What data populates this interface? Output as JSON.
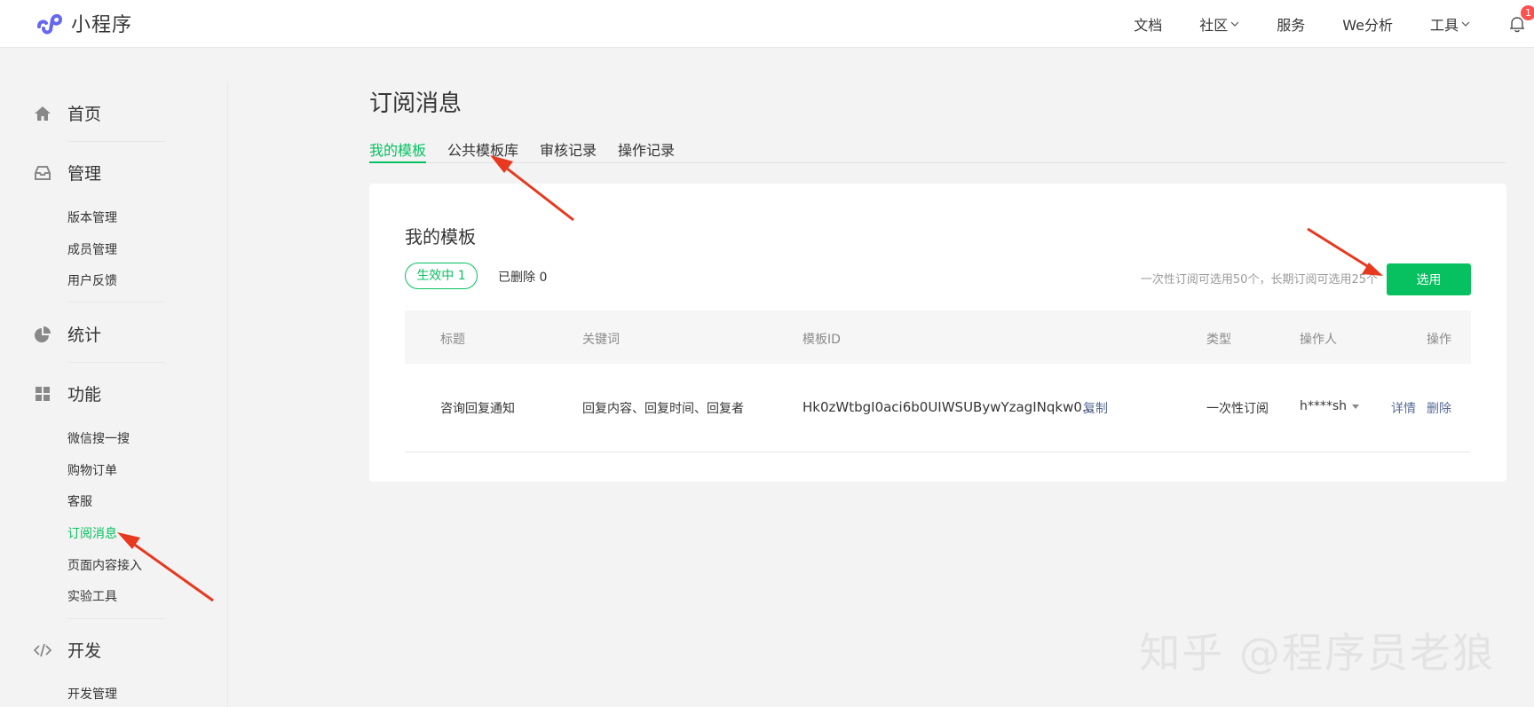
{
  "brand": {
    "name": "小程序",
    "logo_icon": "miniprogram-logo-icon",
    "color": "#6467f0"
  },
  "topnav": {
    "items": [
      {
        "label": "文档",
        "dropdown": false
      },
      {
        "label": "社区",
        "dropdown": true
      },
      {
        "label": "服务",
        "dropdown": false
      },
      {
        "label": "We分析",
        "dropdown": false
      },
      {
        "label": "工具",
        "dropdown": true
      }
    ],
    "notification_count": "1"
  },
  "sidebar": {
    "sections": [
      {
        "label": "首页",
        "icon": "home-icon",
        "items": []
      },
      {
        "label": "管理",
        "icon": "inbox-icon",
        "items": [
          "版本管理",
          "成员管理",
          "用户反馈"
        ]
      },
      {
        "label": "统计",
        "icon": "pie-chart-icon",
        "items": []
      },
      {
        "label": "功能",
        "icon": "grid-icon",
        "items": [
          "微信搜一搜",
          "购物订单",
          "客服",
          "订阅消息",
          "页面内容接入",
          "实验工具"
        ]
      },
      {
        "label": "开发",
        "icon": "code-icon",
        "items": [
          "开发管理"
        ]
      }
    ],
    "active_item": "订阅消息"
  },
  "page": {
    "title": "订阅消息",
    "tabs": [
      "我的模板",
      "公共模板库",
      "审核记录",
      "操作记录"
    ],
    "active_tab": "我的模板"
  },
  "card": {
    "title": "我的模板",
    "active_filter": "生效中  1",
    "deleted_filter": "已删除  0",
    "hint": "一次性订阅可选用50个，长期订阅可选用25个",
    "select_button": "选用"
  },
  "table": {
    "headers": [
      "标题",
      "关键词",
      "模板ID",
      "类型",
      "操作人",
      "操作"
    ],
    "rows": [
      {
        "title": "咨询回复通知",
        "keywords": "回复内容、回复时间、回复者",
        "template_id": "Hk0zWtbgI0aci6b0UIWSUBywYzagINqkw0...",
        "copy": "复制",
        "type": "一次性订阅",
        "operator": "h****sh",
        "action_detail": "详情",
        "action_delete": "删除"
      }
    ]
  },
  "watermark": "知乎 @程序员老狼",
  "colors": {
    "accent": "#07c160",
    "link": "#576b95",
    "annotation": "#e8381e",
    "badge": "#fa5151"
  }
}
